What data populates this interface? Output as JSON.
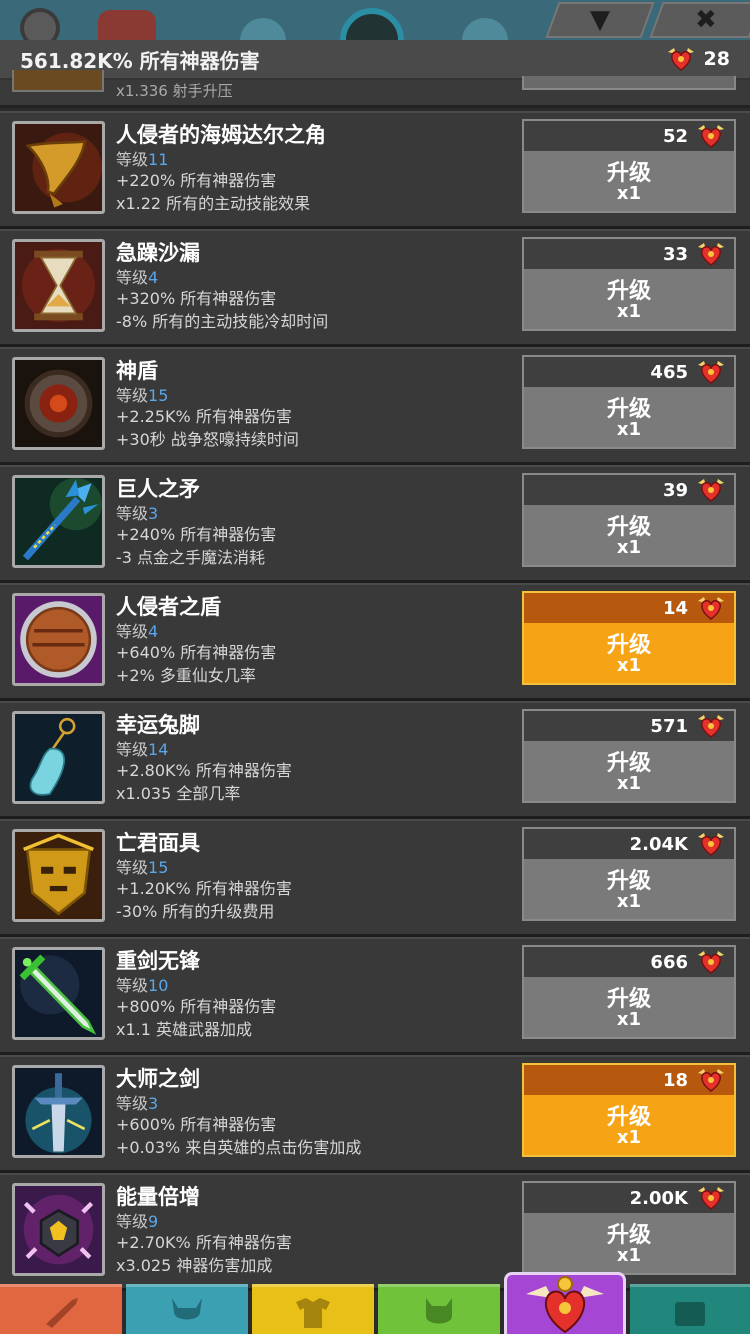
{
  "header": {
    "total_damage": "561.82K% 所有神器伤害",
    "relic_count": "28",
    "collapse_icon": "chevron-down-icon",
    "close_icon": "close-icon"
  },
  "partial_row": {
    "text": "x1.336 射手升压"
  },
  "colors": {
    "gold_button": "#f6a316",
    "gray_button": "#7a7a7a",
    "level_number": "#5aa6e8"
  },
  "upgrade_label": "升级",
  "level_label": "等级",
  "artifacts": [
    {
      "name": "人侵者的海姆达尔之角",
      "level": "11",
      "effect1": "+220% 所有神器伤害",
      "effect2": "x1.22 所有的主动技能效果",
      "cost": "52",
      "multiplier": "x1",
      "affordable": false,
      "icon": "horn-icon"
    },
    {
      "name": "急躁沙漏",
      "level": "4",
      "effect1": "+320% 所有神器伤害",
      "effect2": "-8% 所有的主动技能冷却时间",
      "cost": "33",
      "multiplier": "x1",
      "affordable": false,
      "icon": "hourglass-icon"
    },
    {
      "name": "神盾",
      "level": "15",
      "effect1": "+2.25K% 所有神器伤害",
      "effect2": "+30秒 战争怒嚎持续时间",
      "cost": "465",
      "multiplier": "x1",
      "affordable": false,
      "icon": "aegis-icon"
    },
    {
      "name": "巨人之矛",
      "level": "3",
      "effect1": "+240% 所有神器伤害",
      "effect2": "-3 点金之手魔法消耗",
      "cost": "39",
      "multiplier": "x1",
      "affordable": false,
      "icon": "trident-icon"
    },
    {
      "name": "人侵者之盾",
      "level": "4",
      "effect1": "+640% 所有神器伤害",
      "effect2": "+2% 多重仙女几率",
      "cost": "14",
      "multiplier": "x1",
      "affordable": true,
      "icon": "round-shield-icon"
    },
    {
      "name": "幸运兔脚",
      "level": "14",
      "effect1": "+2.80K% 所有神器伤害",
      "effect2": "x1.035 全部几率",
      "cost": "571",
      "multiplier": "x1",
      "affordable": false,
      "icon": "rabbit-foot-icon"
    },
    {
      "name": "亡君面具",
      "level": "15",
      "effect1": "+1.20K% 所有神器伤害",
      "effect2": "-30% 所有的升级费用",
      "cost": "2.04K",
      "multiplier": "x1",
      "affordable": false,
      "icon": "mask-icon"
    },
    {
      "name": "重剑无锋",
      "level": "10",
      "effect1": "+800% 所有神器伤害",
      "effect2": "x1.1 英雄武器加成",
      "cost": "666",
      "multiplier": "x1",
      "affordable": false,
      "icon": "green-sword-icon"
    },
    {
      "name": "大师之剑",
      "level": "3",
      "effect1": "+600% 所有神器伤害",
      "effect2": "+0.03% 来自英雄的点击伤害加成",
      "cost": "18",
      "multiplier": "x1",
      "affordable": true,
      "icon": "master-sword-icon"
    },
    {
      "name": "能量倍增",
      "level": "9",
      "effect1": "+2.70K% 所有神器伤害",
      "effect2": "x3.025 神器伤害加成",
      "cost": "2.00K",
      "multiplier": "x1",
      "affordable": false,
      "icon": "power-crystal-icon"
    }
  ],
  "tabs": [
    {
      "id": "hero",
      "icon": "sword-icon",
      "color": "#e0673f"
    },
    {
      "id": "heroes",
      "icon": "viking-helmet-icon",
      "color": "#3aa0b2"
    },
    {
      "id": "equipment",
      "icon": "armor-icon",
      "color": "#e9c018"
    },
    {
      "id": "pets",
      "icon": "pet-icon",
      "color": "#6fc23a"
    },
    {
      "id": "artifacts",
      "icon": "winged-heart-icon",
      "color": "#a547d4",
      "active": true
    },
    {
      "id": "shop",
      "icon": "chest-icon",
      "color": "#21877d"
    }
  ]
}
